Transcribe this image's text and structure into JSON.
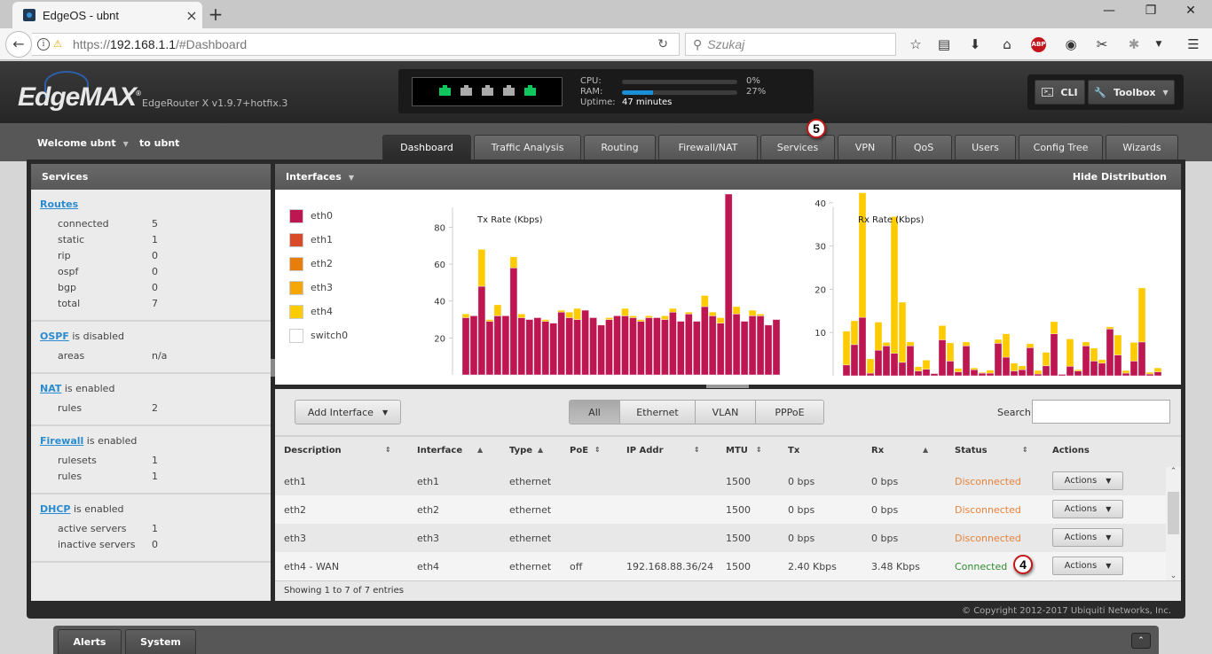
{
  "browser": {
    "tab_title": "EdgeOS - ubnt",
    "url_host": "192.168.1.1",
    "url_prefix": "https://",
    "url_suffix": "/#Dashboard",
    "search_placeholder": "Szukaj",
    "new_tab": "+",
    "close_tab": "×",
    "win_min": "—",
    "win_max": "❐",
    "win_close": "✕"
  },
  "header": {
    "logo": "EdgeMAX",
    "version": "EdgeRouter X v1.9.7+hotfix.3",
    "ports": [
      {
        "name": "eth0",
        "up": true
      },
      {
        "name": "eth1",
        "up": false
      },
      {
        "name": "eth2",
        "up": false
      },
      {
        "name": "eth3",
        "up": false
      },
      {
        "name": "eth4",
        "up": true
      }
    ],
    "cpu_label": "CPU:",
    "cpu_pct": 0,
    "cpu_text": "0%",
    "ram_label": "RAM:",
    "ram_pct": 27,
    "ram_text": "27%",
    "uptime_label": "Uptime:",
    "uptime_value": "47 minutes",
    "cli_label": "CLI",
    "toolbox_label": "Toolbox"
  },
  "subheader": {
    "welcome": "Welcome ubnt",
    "to_ubnt": "to ubnt"
  },
  "nav_tabs": [
    {
      "label": "Dashboard",
      "active": true
    },
    {
      "label": "Traffic Analysis",
      "active": false
    },
    {
      "label": "Routing",
      "active": false
    },
    {
      "label": "Firewall/NAT",
      "active": false
    },
    {
      "label": "Services",
      "active": false
    },
    {
      "label": "VPN",
      "active": false
    },
    {
      "label": "QoS",
      "active": false
    },
    {
      "label": "Users",
      "active": false
    },
    {
      "label": "Config Tree",
      "active": false
    },
    {
      "label": "Wizards",
      "active": false
    }
  ],
  "annotations": {
    "services_badge": "5",
    "connected_badge": "4"
  },
  "services_panel": {
    "title": "Services",
    "groups": [
      {
        "link": "Routes",
        "suffix": "",
        "rows": [
          [
            "connected",
            "5"
          ],
          [
            "static",
            "1"
          ],
          [
            "rip",
            "0"
          ],
          [
            "ospf",
            "0"
          ],
          [
            "bgp",
            "0"
          ],
          [
            "total",
            "7"
          ]
        ]
      },
      {
        "link": "OSPF",
        "suffix": " is disabled",
        "rows": [
          [
            "areas",
            "n/a"
          ]
        ]
      },
      {
        "link": "NAT",
        "suffix": " is enabled",
        "rows": [
          [
            "rules",
            "2"
          ]
        ]
      },
      {
        "link": "Firewall",
        "suffix": " is enabled",
        "rows": [
          [
            "rulesets",
            "1"
          ],
          [
            "rules",
            "1"
          ]
        ]
      },
      {
        "link": "DHCP",
        "suffix": " is enabled",
        "rows": [
          [
            "active servers",
            "1"
          ],
          [
            "inactive servers",
            "0"
          ]
        ]
      }
    ]
  },
  "interfaces_panel": {
    "title": "Interfaces",
    "hide_label": "Hide Distribution",
    "legend": [
      {
        "name": "eth0",
        "color": "#be1650"
      },
      {
        "name": "eth1",
        "color": "#d84a28"
      },
      {
        "name": "eth2",
        "color": "#e87d0a"
      },
      {
        "name": "eth3",
        "color": "#f5a70a"
      },
      {
        "name": "eth4",
        "color": "#fecb00"
      },
      {
        "name": "switch0",
        "color": "#ffffff"
      }
    ]
  },
  "chart_data": [
    {
      "type": "bar",
      "stacked": true,
      "title": "Tx Rate (Kbps)",
      "ylabel": "",
      "yticks": [
        20,
        40,
        60,
        80
      ],
      "ylim": [
        0,
        98
      ],
      "series": [
        {
          "name": "eth0",
          "color": "#be1650",
          "values": [
            31,
            32,
            48,
            29,
            32,
            32,
            58,
            31,
            30,
            31,
            29,
            28,
            34,
            31,
            30,
            35,
            31,
            27,
            30,
            32,
            32,
            31,
            29,
            31,
            31,
            30,
            34,
            29,
            33,
            29,
            37,
            32,
            28,
            98,
            33,
            29,
            32,
            32,
            27,
            30
          ]
        },
        {
          "name": "eth4",
          "color": "#fecb00",
          "values": [
            2,
            0,
            20,
            1,
            6,
            0,
            6,
            2,
            0,
            0,
            1,
            0,
            1,
            3,
            6,
            0,
            0,
            0,
            1,
            0,
            4,
            1,
            1,
            1,
            0,
            2,
            2,
            0,
            1,
            0,
            6,
            2,
            3,
            0,
            4,
            0,
            3,
            1,
            0,
            0
          ]
        }
      ]
    },
    {
      "type": "bar",
      "stacked": true,
      "title": "Rx Rate (Kbps)",
      "ylabel": "",
      "yticks": [
        10,
        20,
        30,
        40
      ],
      "ylim": [
        0,
        42
      ],
      "series": [
        {
          "name": "eth0",
          "color": "#be1650",
          "values": [
            2.5,
            7.2,
            13.5,
            0.6,
            5.9,
            6.9,
            5.2,
            3.1,
            6.9,
            1.1,
            1.5,
            0.5,
            8.3,
            3.4,
            0.9,
            6.9,
            1.4,
            0.6,
            0.6,
            7.5,
            4.3,
            1.1,
            1.4,
            6.5,
            0.4,
            2.3,
            9.7,
            0.3,
            2.2,
            1.1,
            6.9,
            3.4,
            2.9,
            10.8,
            4.8,
            0.6,
            3.4,
            7.8,
            0.4,
            0.9
          ]
        },
        {
          "name": "eth4",
          "color": "#fecb00",
          "values": [
            7.8,
            5.5,
            28.8,
            3.3,
            6.5,
            0.8,
            31.6,
            13.9,
            0.9,
            1,
            2.1,
            0,
            3.3,
            4.2,
            0.8,
            0.9,
            0.4,
            0.2,
            0.7,
            0.9,
            5.4,
            1.8,
            0.9,
            0.9,
            0.8,
            3.1,
            2.8,
            0,
            6.3,
            0.3,
            0.9,
            3,
            0.8,
            0.5,
            4.6,
            0.6,
            4.3,
            12.5,
            0.4,
            0.9
          ]
        }
      ]
    }
  ],
  "table_toolbar": {
    "add_interface": "Add Interface",
    "filters": [
      {
        "label": "All",
        "active": true
      },
      {
        "label": "Ethernet",
        "active": false
      },
      {
        "label": "VLAN",
        "active": false
      },
      {
        "label": "PPPoE",
        "active": false
      }
    ],
    "search_label": "Search",
    "search_value": ""
  },
  "table": {
    "columns": [
      "Description",
      "Interface",
      "Type",
      "PoE",
      "IP Addr",
      "MTU",
      "Tx",
      "Rx",
      "Status",
      "Actions"
    ],
    "rows": [
      {
        "description": "eth1",
        "interface": "eth1",
        "type": "ethernet",
        "poe": "",
        "ip": "",
        "mtu": "1500",
        "tx": "0 bps",
        "rx": "0 bps",
        "status": "Disconnected",
        "status_kind": "disc",
        "action": "Actions"
      },
      {
        "description": "eth2",
        "interface": "eth2",
        "type": "ethernet",
        "poe": "",
        "ip": "",
        "mtu": "1500",
        "tx": "0 bps",
        "rx": "0 bps",
        "status": "Disconnected",
        "status_kind": "disc",
        "action": "Actions"
      },
      {
        "description": "eth3",
        "interface": "eth3",
        "type": "ethernet",
        "poe": "",
        "ip": "",
        "mtu": "1500",
        "tx": "0 bps",
        "rx": "0 bps",
        "status": "Disconnected",
        "status_kind": "disc",
        "action": "Actions"
      },
      {
        "description": "eth4 - WAN",
        "interface": "eth4",
        "type": "ethernet",
        "poe": "off",
        "ip": "192.168.88.36/24",
        "mtu": "1500",
        "tx": "2.40 Kbps",
        "rx": "3.48 Kbps",
        "status": "Connected",
        "status_kind": "conn",
        "action": "Actions"
      }
    ],
    "footer": "Showing 1 to 7 of 7 entries"
  },
  "copyright": "© Copyright 2012-2017 Ubiquiti Networks, Inc.",
  "bottom_tabs": [
    "Alerts",
    "System"
  ]
}
